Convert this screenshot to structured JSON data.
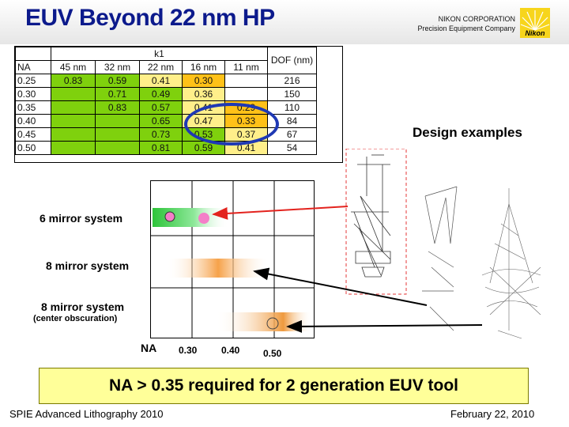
{
  "slide": {
    "title": "EUV Beyond 22 nm HP",
    "company_line1": "NIKON CORPORATION",
    "company_line2": "Precision Equipment Company",
    "logo_text": "Nikon"
  },
  "k1_table": {
    "group_header": "k1",
    "col_na": "NA",
    "col_dof": "DOF (nm)",
    "nodes": [
      "45 nm",
      "32 nm",
      "22 nm",
      "16 nm",
      "11 nm"
    ],
    "rows": [
      {
        "na": "0.25",
        "cells": [
          "0.83",
          "0.59",
          "0.41",
          "0.30",
          ""
        ],
        "dof": "216"
      },
      {
        "na": "0.30",
        "cells": [
          "",
          "0.71",
          "0.49",
          "0.36",
          ""
        ],
        "dof": "150"
      },
      {
        "na": "0.35",
        "cells": [
          "",
          "0.83",
          "0.57",
          "0.41",
          "0.29"
        ],
        "dof": "110"
      },
      {
        "na": "0.40",
        "cells": [
          "",
          "",
          "0.65",
          "0.47",
          "0.33"
        ],
        "dof": "84"
      },
      {
        "na": "0.45",
        "cells": [
          "",
          "",
          "0.73",
          "0.53",
          "0.37"
        ],
        "dof": "67"
      },
      {
        "na": "0.50",
        "cells": [
          "",
          "",
          "0.81",
          "0.59",
          "0.41"
        ],
        "dof": "54"
      }
    ],
    "colors": {
      "green": "#7fd10d",
      "yellow": "#ffef8a",
      "orange": "#ffc118",
      "highlight_ellipse": "#1f39b4"
    }
  },
  "design_examples_label": "Design examples",
  "na_chart": {
    "rows": [
      {
        "label": "6 mirror system",
        "sub": ""
      },
      {
        "label": "8 mirror system",
        "sub": ""
      },
      {
        "label": "8 mirror system",
        "sub": "(center obscuration)"
      }
    ],
    "axis_label": "NA",
    "ticks": [
      "0.30",
      "0.40",
      "0.50"
    ]
  },
  "banner_text": "NA > 0.35 required for 2 generation EUV tool",
  "footer": {
    "left": "SPIE Advanced Lithography 2010",
    "right": "February 22, 2010"
  }
}
